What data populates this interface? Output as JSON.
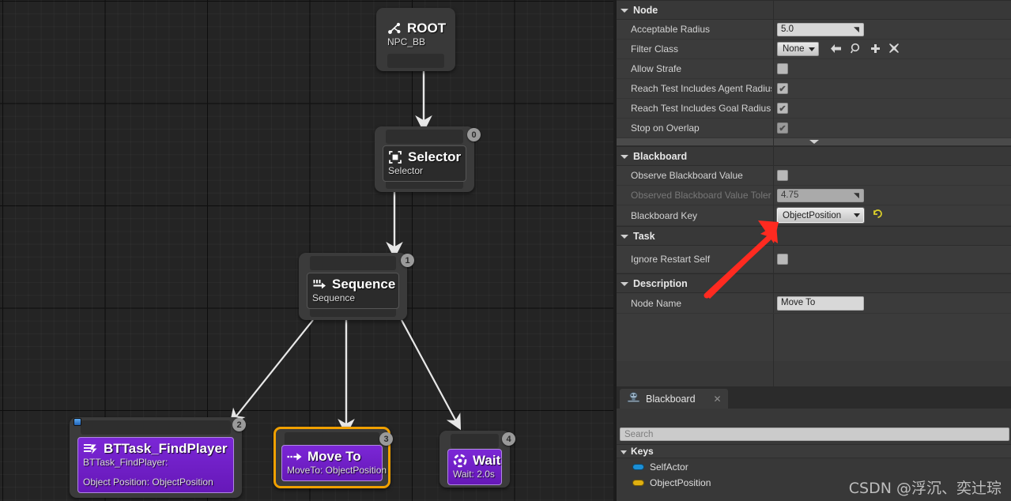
{
  "graph": {
    "nodes": [
      {
        "id": "root",
        "title": "ROOT",
        "subtitle": "NPC_BB",
        "icon": "root-node-icon",
        "index": null,
        "kind": "root"
      },
      {
        "id": "selector",
        "title": "Selector",
        "subtitle": "Selector",
        "icon": "selector-composite-icon",
        "index": "0",
        "kind": "composite"
      },
      {
        "id": "sequence",
        "title": "Sequence",
        "subtitle": "Sequence",
        "icon": "sequence-composite-icon",
        "index": "1",
        "kind": "composite"
      },
      {
        "id": "find-player",
        "title": "BTTask_FindPlayer",
        "subtitle": "BTTask_FindPlayer:",
        "subtitle2": "Object Position: ObjectPosition",
        "icon": "blueprint-task-icon",
        "index": "2",
        "kind": "task"
      },
      {
        "id": "move-to",
        "title": "Move To",
        "subtitle": "MoveTo: ObjectPosition",
        "icon": "move-to-icon",
        "index": "3",
        "kind": "task",
        "selected": true
      },
      {
        "id": "wait",
        "title": "Wait",
        "subtitle": "Wait: 2.0s",
        "icon": "wait-clock-icon",
        "index": "4",
        "kind": "task"
      }
    ]
  },
  "details": {
    "categories": [
      {
        "name": "Node",
        "rows": [
          {
            "label": "Acceptable Radius",
            "type": "numeric",
            "value": "5.0"
          },
          {
            "label": "Filter Class",
            "type": "class-picker",
            "value": "None",
            "actions": [
              "back-arrow-icon",
              "browse-icon",
              "add-icon",
              "clear-icon"
            ]
          },
          {
            "label": "Allow Strafe",
            "type": "checkbox",
            "checked": false
          },
          {
            "label": "Reach Test Includes Agent Radius",
            "type": "checkbox",
            "checked": true
          },
          {
            "label": "Reach Test Includes Goal Radius",
            "type": "checkbox",
            "checked": true
          },
          {
            "label": "Stop on Overlap",
            "type": "checkbox",
            "checked": true,
            "disabled": true
          }
        ]
      },
      {
        "name": "Blackboard",
        "rows": [
          {
            "label": "Observe Blackboard Value",
            "type": "checkbox",
            "checked": false
          },
          {
            "label": "Observed Blackboard Value Toleran",
            "type": "numeric",
            "value": "4.75",
            "disabled": true
          },
          {
            "label": "Blackboard Key",
            "type": "dropdown",
            "value": "ObjectPosition",
            "focused": true,
            "reset": "reset-to-default-icon"
          }
        ]
      },
      {
        "name": "Task",
        "rows": [
          {
            "label": "Ignore Restart Self",
            "type": "checkbox",
            "checked": false
          }
        ]
      },
      {
        "name": "Description",
        "rows": [
          {
            "label": "Node Name",
            "type": "text",
            "value": "Move To"
          }
        ]
      }
    ]
  },
  "blackboard_panel": {
    "tab_label": "Blackboard",
    "tab_icon": "blackboard-asset-icon",
    "close_icon": "close-icon",
    "search_placeholder": "Search",
    "section_label": "Keys",
    "keys": [
      {
        "name": "SelfActor",
        "color": "#1b8fd6"
      },
      {
        "name": "ObjectPosition",
        "color": "#e0b010"
      }
    ]
  },
  "watermark": "CSDN @浮沉、奕辻琮",
  "colors": {
    "task_purple": "#6c1fc0",
    "selection_orange": "#f0a000",
    "annotation_red": "#ff2a20",
    "graph_bg": "#242424",
    "panel_bg": "#383838"
  }
}
